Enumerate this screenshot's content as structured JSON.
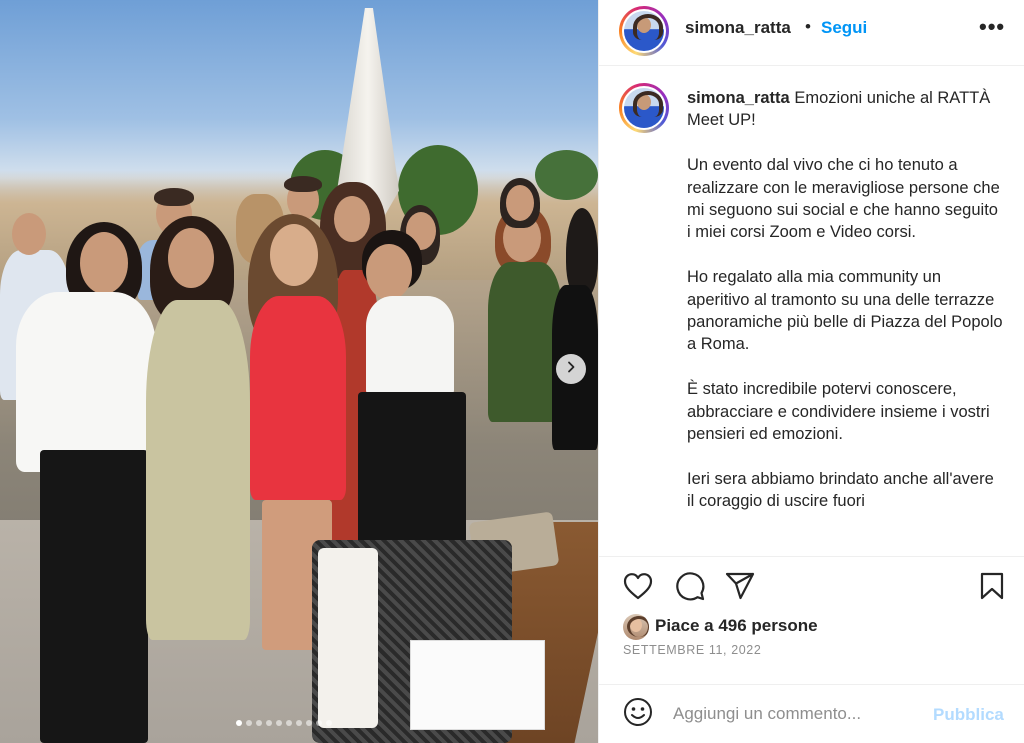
{
  "post": {
    "username": "simona_ratta",
    "separator": "•",
    "follow_label": "Segui",
    "more_icon": "more-horizontal-icon",
    "more_label": "•••"
  },
  "caption": {
    "username": "simona_ratta",
    "paragraphs": [
      "Emozioni uniche al RATTÀ Meet UP!",
      "Un evento dal vivo che ci ho tenuto a realizzare con le meravigliose persone che mi seguono sui social e che hanno seguito i miei corsi Zoom e Video corsi.",
      "Ho regalato alla mia community un aperitivo al tramonto su una delle terrazze panoramiche più belle di Piazza del Popolo a Roma.",
      "È stato incredibile potervi conoscere, abbracciare e condividere insieme i vostri pensieri ed emozioni.",
      "Ieri sera abbiamo brindato anche all'avere il coraggio di uscire fuori"
    ]
  },
  "actions": {
    "like_icon": "heart-icon",
    "comment_icon": "comment-icon",
    "share_icon": "share-icon",
    "save_icon": "bookmark-icon"
  },
  "likes": {
    "text": "Piace a 496 persone"
  },
  "date": "SETTEMBRE 11, 2022",
  "comment": {
    "emoji_icon": "emoji-icon",
    "placeholder": "Aggiungi un commento...",
    "publish_label": "Pubblica"
  },
  "carousel": {
    "next_icon": "chevron-right-icon",
    "total": 10,
    "current": 1
  },
  "colors": {
    "link_blue": "#0095f6",
    "publish_disabled": "#b3dbff",
    "text": "#262626",
    "muted": "#8e8e8e"
  }
}
